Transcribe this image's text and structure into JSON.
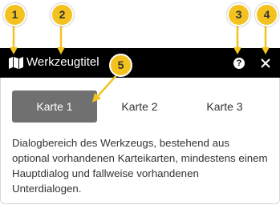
{
  "dialog": {
    "title": "Werkzeugtitel",
    "help_label": "?",
    "close_label": "×"
  },
  "tabs": [
    {
      "label": "Karte 1",
      "active": true
    },
    {
      "label": "Karte 2",
      "active": false
    },
    {
      "label": "Karte 3",
      "active": false
    }
  ],
  "body_text": "Dialogbereich des Werkzeugs, bestehend aus optional vorhandenen Karteikarten, mindestens einem Hauptdialog und fallweise vorhandenen Unterdialogen.",
  "markers": [
    "1",
    "2",
    "3",
    "4",
    "5"
  ],
  "colors": {
    "titlebar": "#000000",
    "active_tab": "#707070",
    "marker": "#f4c21f"
  },
  "icons": {
    "title_icon": "map-icon",
    "help": "question-circle-icon",
    "close": "close-icon"
  }
}
